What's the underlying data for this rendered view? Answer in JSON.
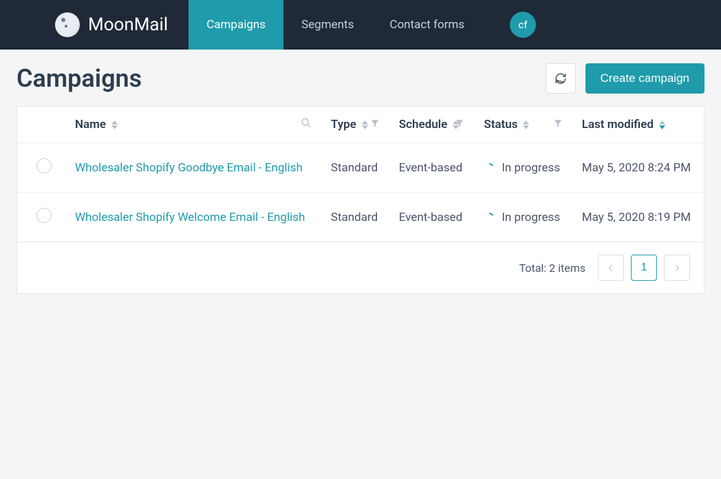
{
  "brand": {
    "name": "MoonMail"
  },
  "nav": {
    "tabs": [
      {
        "label": "Campaigns",
        "active": true
      },
      {
        "label": "Segments",
        "active": false
      },
      {
        "label": "Contact forms",
        "active": false
      }
    ]
  },
  "avatar": {
    "initials": "cf"
  },
  "page": {
    "title": "Campaigns",
    "create_label": "Create campaign"
  },
  "table": {
    "columns": {
      "name": "Name",
      "type": "Type",
      "schedule": "Schedule",
      "status": "Status",
      "last_modified": "Last modified"
    },
    "rows": [
      {
        "name": "Wholesaler Shopify Goodbye Email - English",
        "type": "Standard",
        "schedule": "Event-based",
        "status": "In progress",
        "last_modified": "May 5, 2020 8:24 PM"
      },
      {
        "name": "Wholesaler Shopify Welcome Email - English",
        "type": "Standard",
        "schedule": "Event-based",
        "status": "In progress",
        "last_modified": "May 5, 2020 8:19 PM"
      }
    ]
  },
  "footer": {
    "total_text": "Total: 2 items",
    "current_page": "1"
  },
  "colors": {
    "accent": "#1f9bab",
    "header": "#1f2937"
  }
}
